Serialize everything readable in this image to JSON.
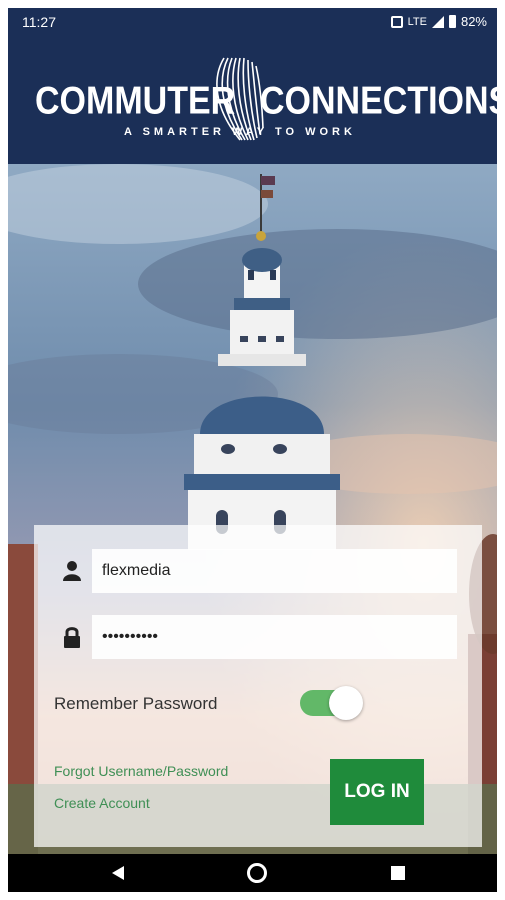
{
  "status_bar": {
    "time": "11:27",
    "network": "LTE",
    "battery": "82%"
  },
  "header": {
    "logo_left": "COMMUTER",
    "logo_right": "CONNECTIONS",
    "tagline": "A SMARTER WAY TO WORK"
  },
  "login": {
    "username_value": "flexmedia",
    "password_masked": "••••••••••",
    "remember_label": "Remember Password",
    "remember_on": true,
    "forgot_link": "Forgot Username/Password",
    "create_link": "Create Account",
    "login_button": "LOG IN"
  },
  "colors": {
    "header_bg": "#1b2f57",
    "link": "#3f8f55",
    "button": "#1f8b3b",
    "toggle_track": "#62b868"
  },
  "icons": {
    "username": "person-icon",
    "password": "lock-icon",
    "nav_back": "back-triangle-icon",
    "nav_home": "home-circle-icon",
    "nav_recents": "recents-square-icon"
  }
}
